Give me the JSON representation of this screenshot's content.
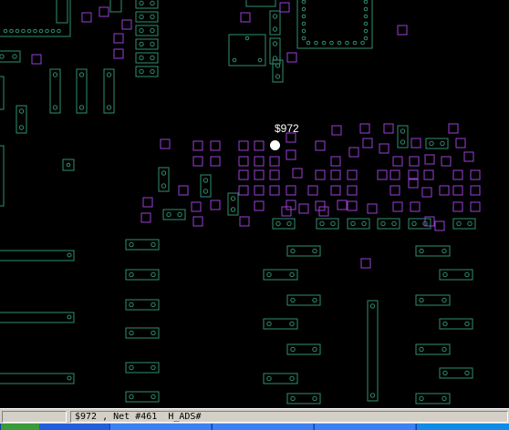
{
  "cursor_label": "$972",
  "status": {
    "left": "",
    "message": "$972 , Net #461  H_ADS#"
  },
  "colors": {
    "background": "#000000",
    "pad_outline": "#2f8f6f",
    "via_outline": "#9a3fd6",
    "selected_pin": "#ffffff",
    "status_bar": "#d4d0c8",
    "taskbar": "#245edb"
  },
  "icons": {
    "selected_pin": "selected-pin-icon"
  }
}
